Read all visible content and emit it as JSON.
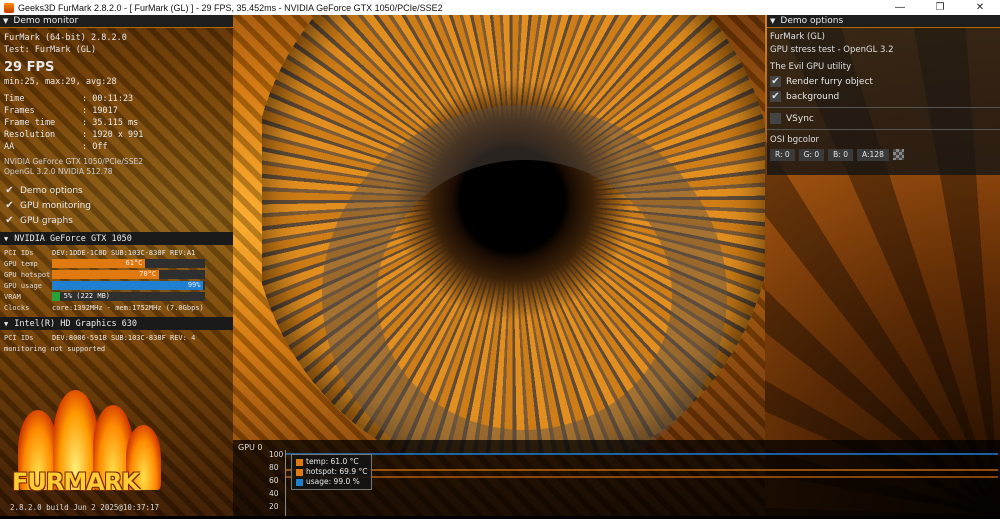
{
  "window": {
    "title": "Geeks3D FurMark 2.8.2.0 - [ FurMark (GL) ] - 29 FPS, 35.452ms - NVIDIA GeForce GTX 1050/PCIe/SSE2",
    "minimize": "—",
    "maximize": "❐",
    "close": "✕"
  },
  "demo_monitor": {
    "header": "Demo monitor",
    "app": "FurMark (64-bit) 2.8.2.0",
    "test": "Test: FurMark (GL)",
    "fps": "29 FPS",
    "fps_stats": "min:25, max:29, avg:28",
    "stats": [
      {
        "label": "Time",
        "value": ": 00:11:23"
      },
      {
        "label": "Frames",
        "value": ": 19017"
      },
      {
        "label": "Frame time",
        "value": ": 35.115 ms"
      },
      {
        "label": "Resolution",
        "value": ": 1920 x 991"
      },
      {
        "label": "AA",
        "value": ": Off"
      }
    ],
    "renderer": "NVIDIA GeForce GTX 1050/PCIe/SSE2",
    "opengl": "OpenGL 3.2.0 NVIDIA 512.78",
    "checks": [
      "Demo options",
      "GPU monitoring",
      "GPU graphs"
    ]
  },
  "gpu1": {
    "name": "NVIDIA GeForce GTX 1050",
    "pci_label": "PCI IDs",
    "pci_value": "DEV:1DDE-1C8D SUB:103C-838F REV:A1",
    "temp": {
      "label": "GPU temp",
      "text": "61°C",
      "fraction": 0.61,
      "color": "#e07a10"
    },
    "hotspot": {
      "label": "GPU hotspot",
      "text": "70°C",
      "fraction": 0.7,
      "color": "#e07a10"
    },
    "usage": {
      "label": "GPU usage",
      "text": "99%",
      "fraction": 0.99,
      "color": "#1f7fd0"
    },
    "vram": {
      "label": "VRAM",
      "text": "5% (222 MB)",
      "fraction": 0.05,
      "color": "#2aa03a"
    },
    "clocks_label": "Clocks",
    "clocks_value": "core:1392MHz - mem:1752MHz (7.0Gbps)"
  },
  "gpu2": {
    "name": "Intel(R) HD Graphics 630",
    "pci_label": "PCI IDs",
    "pci_value": "DEV:8086-591B SUB:103C-838F REV: 4",
    "note": "monitoring not supported"
  },
  "logo": {
    "text": "FURMARK"
  },
  "build": "2.8.2.0 build Jun  2 2025@10:37:17",
  "demo_options": {
    "header": "Demo options",
    "title": "FurMark (GL)",
    "subtitle": "GPU stress test - OpenGL 3.2",
    "utility": "The Evil GPU utility",
    "render_furry": "Render furry object",
    "background": "background",
    "vsync": "VSync",
    "osi_label": "OSI bgcolor",
    "r": "R: 0",
    "g": "G: 0",
    "b": "B: 0",
    "a": "A:128"
  },
  "graph": {
    "title": "GPU 0",
    "yticks": [
      "100",
      "80",
      "60",
      "40",
      "20"
    ],
    "legend": [
      {
        "text": "temp: 61.0 °C",
        "color": "#e07a10"
      },
      {
        "text": "hotspot: 69.9 °C",
        "color": "#e07a10"
      },
      {
        "text": "usage: 99.0 %",
        "color": "#1f7fd0"
      }
    ]
  }
}
